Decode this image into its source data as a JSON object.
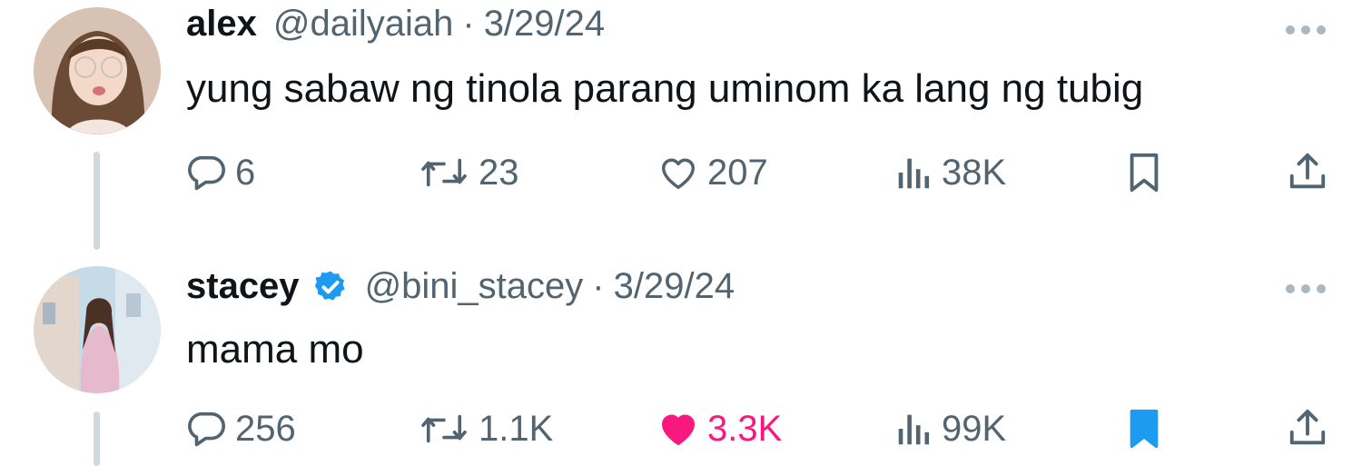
{
  "tweets": [
    {
      "name": "alex",
      "handle": "@dailyaiah",
      "separator": "·",
      "date": "3/29/24",
      "verified": false,
      "text": "yung sabaw ng tinola parang uminom ka lang ng tubig",
      "metrics": {
        "replies": "6",
        "reposts": "23",
        "likes": "207",
        "views": "38K"
      },
      "liked": false,
      "bookmarked": false
    },
    {
      "name": "stacey",
      "handle": "@bini_stacey",
      "separator": "·",
      "date": "3/29/24",
      "verified": true,
      "text": "mama mo",
      "metrics": {
        "replies": "256",
        "reposts": "1.1K",
        "likes": "3.3K",
        "views": "99K"
      },
      "liked": true,
      "bookmarked": true
    }
  ],
  "colors": {
    "text_primary": "#0f1419",
    "text_secondary": "#536471",
    "like_active": "#f91880",
    "bookmark_active": "#1d9bf0",
    "verified_badge": "#1d9bf0",
    "thread_line": "#cfd9de"
  },
  "icons": [
    "reply-icon",
    "repost-icon",
    "like-icon",
    "views-icon",
    "bookmark-icon",
    "share-icon",
    "more-icon",
    "verified-badge-icon"
  ]
}
